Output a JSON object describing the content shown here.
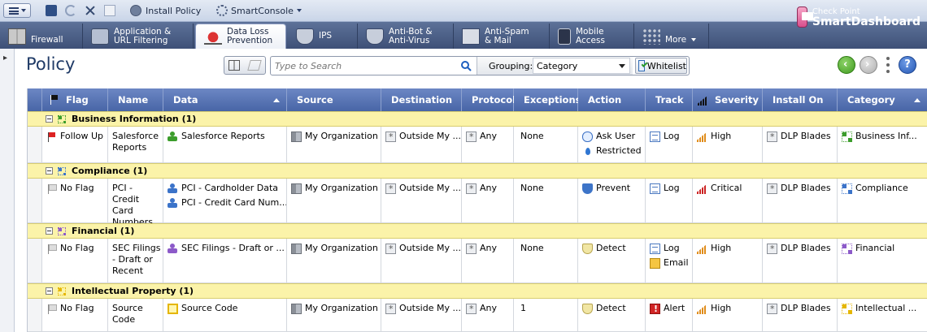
{
  "toolbar": {
    "install_policy": "Install Policy",
    "smartconsole": "SmartConsole"
  },
  "brand": {
    "line1": "Check Point",
    "line2": "SmartDashboard"
  },
  "tabs": [
    {
      "label_1": "Firewall",
      "label_2": ""
    },
    {
      "label_1": "Application &",
      "label_2": "URL Filtering"
    },
    {
      "label_1": "Data Loss",
      "label_2": "Prevention"
    },
    {
      "label_1": "IPS",
      "label_2": ""
    },
    {
      "label_1": "Anti-Bot &",
      "label_2": "Anti-Virus"
    },
    {
      "label_1": "Anti-Spam",
      "label_2": "& Mail"
    },
    {
      "label_1": "Mobile",
      "label_2": "Access"
    },
    {
      "label_1": "More",
      "label_2": ""
    }
  ],
  "policy": {
    "title": "Policy",
    "search_placeholder": "Type to Search",
    "grouping_label": "Grouping:",
    "grouping_value": "Category",
    "whitelist": "Whitelist",
    "help": "?"
  },
  "columns": [
    "Flag",
    "Name",
    "Data",
    "Source",
    "Destination",
    "Protocol",
    "Exceptions",
    "Action",
    "Track",
    "Severity",
    "Install On",
    "Category"
  ],
  "groups": [
    {
      "title": "Business Information",
      "count": "(1)"
    },
    {
      "title": "Compliance",
      "count": "(1)"
    },
    {
      "title": "Financial",
      "count": "(1)"
    },
    {
      "title": "Intellectual Property",
      "count": "(1)"
    }
  ],
  "rows": [
    {
      "flag": "Follow Up",
      "name": [
        "Salesforce",
        "Reports"
      ],
      "data": [
        "Salesforce Reports"
      ],
      "source": "My Organization",
      "destination": "Outside My ...",
      "protocol": "Any",
      "exceptions": "None",
      "action": [
        "Ask User",
        "Restricted"
      ],
      "track": [
        "Log"
      ],
      "severity": "High",
      "install_on": "DLP Blades",
      "category": "Business Inf..."
    },
    {
      "flag": "No Flag",
      "name": [
        "PCI -",
        "Credit Card",
        "Numbers"
      ],
      "data": [
        "PCI - Cardholder Data",
        "PCI - Credit Card Num..."
      ],
      "source": "My Organization",
      "destination": "Outside My ...",
      "protocol": "Any",
      "exceptions": "None",
      "action": [
        "Prevent"
      ],
      "track": [
        "Log"
      ],
      "severity": "Critical",
      "install_on": "DLP Blades",
      "category": "Compliance"
    },
    {
      "flag": "No Flag",
      "name": [
        "SEC Filings",
        "- Draft or",
        "Recent"
      ],
      "data": [
        "SEC Filings - Draft or ..."
      ],
      "source": "My Organization",
      "destination": "Outside My ...",
      "protocol": "Any",
      "exceptions": "None",
      "action": [
        "Detect"
      ],
      "track": [
        "Log",
        "Email"
      ],
      "severity": "High",
      "install_on": "DLP Blades",
      "category": "Financial"
    },
    {
      "flag": "No Flag",
      "name": [
        "Source",
        "Code"
      ],
      "data": [
        "Source Code"
      ],
      "source": "My Organization",
      "destination": "Outside My ...",
      "protocol": "Any",
      "exceptions": "1",
      "action": [
        "Detect"
      ],
      "track": [
        "Alert"
      ],
      "severity": "High",
      "install_on": "DLP Blades",
      "category": "Intellectual ..."
    }
  ]
}
